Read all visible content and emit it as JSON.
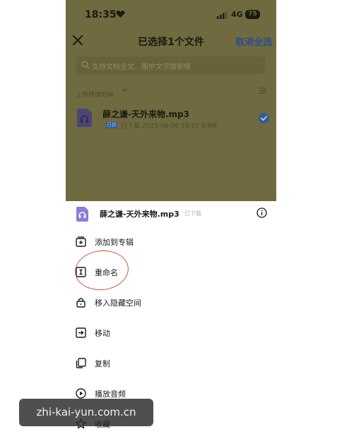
{
  "status_bar": {
    "time": "18:35",
    "network": "4G",
    "battery": "75"
  },
  "nav": {
    "title": "已选择1个文件",
    "deselect_all": "取消全选"
  },
  "search": {
    "placeholder": "支持文档全文、图中文字搜索哦"
  },
  "sort": {
    "label": "上传修改时间"
  },
  "file": {
    "name": "薛之谦-天外来物.mp3",
    "tag": "已存",
    "meta": "已下载   2023-06-06 16:20   9.8M",
    "selected": true
  },
  "sheet": {
    "file_name": "薛之谦-天外来物.mp3",
    "file_status": "已下载",
    "menu": [
      {
        "label": "添加到专辑",
        "icon": "add-album-icon"
      },
      {
        "label": "重命名",
        "icon": "rename-icon"
      },
      {
        "label": "移入隐藏空间",
        "icon": "lock-icon"
      },
      {
        "label": "移动",
        "icon": "move-icon"
      },
      {
        "label": "复制",
        "icon": "copy-icon"
      },
      {
        "label": "播放音频",
        "icon": "play-icon"
      },
      {
        "label": "收藏",
        "icon": "star-icon"
      }
    ]
  },
  "watermark": {
    "text": "zhi-kai-yun.com.cn"
  },
  "colors": {
    "dim_overlay": "#6f6a3f",
    "accent_blue": "#2a4e8a",
    "check_blue": "#2f5b9e",
    "annotation_red": "#d2563d",
    "file_icon_purple": "#8b7fd6"
  }
}
